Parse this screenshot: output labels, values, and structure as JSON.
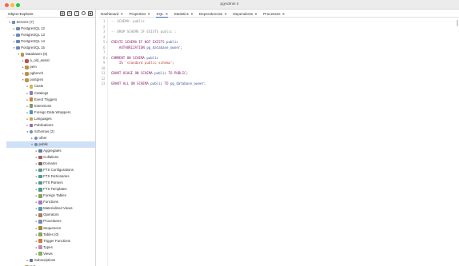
{
  "window": {
    "title": "pgAdmin 4"
  },
  "explorer": {
    "title": "Object Explorer",
    "toolbar": [
      {
        "name": "table-view-icon",
        "glyph": "▦"
      },
      {
        "name": "grid-icon",
        "glyph": "⊞"
      },
      {
        "name": "sql-icon",
        "glyph": "≡"
      },
      {
        "name": "search-icon",
        "glyph": "⌕"
      },
      {
        "name": "terminal-icon",
        "glyph": "▣"
      }
    ],
    "tree": [
      {
        "depth": 0,
        "caret": "▾",
        "icon": "ic-server",
        "label": "Servers (7)"
      },
      {
        "depth": 1,
        "caret": "▸",
        "icon": "ic-server",
        "label": "PostgreSQL 12"
      },
      {
        "depth": 1,
        "caret": "▸",
        "icon": "ic-server",
        "label": "PostgreSQL 13"
      },
      {
        "depth": 1,
        "caret": "▸",
        "icon": "ic-server",
        "label": "PostgreSQL 14"
      },
      {
        "depth": 1,
        "caret": "▾",
        "icon": "ic-server",
        "label": "PostgreSQL 15"
      },
      {
        "depth": 2,
        "caret": "▾",
        "icon": "ic-db",
        "label": "Databases (5)"
      },
      {
        "depth": 3,
        "caret": "▸",
        "icon": "ic-db-red",
        "label": "a_old_assist"
      },
      {
        "depth": 3,
        "caret": "▸",
        "icon": "ic-db",
        "label": "pem"
      },
      {
        "depth": 3,
        "caret": "▸",
        "icon": "ic-db",
        "label": "pgbench"
      },
      {
        "depth": 3,
        "caret": "▾",
        "icon": "ic-db",
        "label": "postgres"
      },
      {
        "depth": 4,
        "caret": "▸",
        "icon": "ic-folder",
        "label": "Casts"
      },
      {
        "depth": 4,
        "caret": "▸",
        "icon": "ic-cat",
        "label": "Catalogs"
      },
      {
        "depth": 4,
        "caret": "▸",
        "icon": "ic-trigger",
        "label": "Event Triggers"
      },
      {
        "depth": 4,
        "caret": "▸",
        "icon": "ic-ext",
        "label": "Extensions"
      },
      {
        "depth": 4,
        "caret": "▸",
        "icon": "ic-fdw",
        "label": "Foreign Data Wrappers"
      },
      {
        "depth": 4,
        "caret": "▸",
        "icon": "ic-lang",
        "label": "Languages"
      },
      {
        "depth": 4,
        "caret": "▸",
        "icon": "ic-pub",
        "label": "Publications"
      },
      {
        "depth": 4,
        "caret": "▾",
        "icon": "ic-schema",
        "label": "Schemas (2)"
      },
      {
        "depth": 5,
        "caret": "▸",
        "icon": "ic-schema",
        "label": "other"
      },
      {
        "depth": 5,
        "caret": "▾",
        "icon": "ic-schema",
        "label": "public",
        "selected": true
      },
      {
        "depth": 6,
        "caret": "▸",
        "icon": "ic-agg",
        "label": "Aggregates"
      },
      {
        "depth": 6,
        "caret": "▸",
        "icon": "ic-coll",
        "label": "Collations"
      },
      {
        "depth": 6,
        "caret": "▸",
        "icon": "ic-dom",
        "label": "Domains"
      },
      {
        "depth": 6,
        "caret": "▸",
        "icon": "ic-fts",
        "label": "FTS Configurations"
      },
      {
        "depth": 6,
        "caret": "▸",
        "icon": "ic-fts",
        "label": "FTS Dictionaries"
      },
      {
        "depth": 6,
        "caret": "▸",
        "icon": "ic-fts",
        "label": "FTS Parsers"
      },
      {
        "depth": 6,
        "caret": "▸",
        "icon": "ic-fts",
        "label": "FTS Templates"
      },
      {
        "depth": 6,
        "caret": "▸",
        "icon": "ic-table",
        "label": "Foreign Tables"
      },
      {
        "depth": 6,
        "caret": "▸",
        "icon": "ic-fn",
        "label": "Functions"
      },
      {
        "depth": 6,
        "caret": "▸",
        "icon": "ic-mview",
        "label": "Materialized Views"
      },
      {
        "depth": 6,
        "caret": "▸",
        "icon": "ic-op",
        "label": "Operators"
      },
      {
        "depth": 6,
        "caret": "▸",
        "icon": "ic-proc",
        "label": "Procedures"
      },
      {
        "depth": 6,
        "caret": "▸",
        "icon": "ic-seq",
        "label": "Sequences"
      },
      {
        "depth": 6,
        "caret": "▸",
        "icon": "ic-table",
        "label": "Tables (0)"
      },
      {
        "depth": 6,
        "caret": "▸",
        "icon": "ic-trigger",
        "label": "Trigger Functions"
      },
      {
        "depth": 6,
        "caret": "▸",
        "icon": "ic-type",
        "label": "Types"
      },
      {
        "depth": 6,
        "caret": "▸",
        "icon": "ic-view",
        "label": "Views"
      },
      {
        "depth": 4,
        "caret": "▸",
        "icon": "ic-sub",
        "label": "Subscriptions"
      },
      {
        "depth": 3,
        "caret": "▸",
        "icon": "ic-db",
        "label": "test"
      }
    ]
  },
  "tabs": [
    {
      "label": "Dashboard",
      "active": false
    },
    {
      "label": "Properties",
      "active": false
    },
    {
      "label": "SQL",
      "active": true
    },
    {
      "label": "Statistics",
      "active": false
    },
    {
      "label": "Dependencies",
      "active": false
    },
    {
      "label": "Dependents",
      "active": false
    },
    {
      "label": "Processes",
      "active": false
    }
  ],
  "tab_close_glyph": "×",
  "editor": {
    "lines": [
      {
        "n": "1",
        "fold": "",
        "tokens": [
          {
            "t": "-- SCHEMA: public",
            "c": "tok-comment"
          }
        ]
      },
      {
        "n": "2",
        "fold": "",
        "tokens": []
      },
      {
        "n": "3",
        "fold": "",
        "tokens": [
          {
            "t": "-- DROP SCHEMA IF EXISTS public ;",
            "c": "tok-comment"
          }
        ]
      },
      {
        "n": "4",
        "fold": "",
        "tokens": []
      },
      {
        "n": "5",
        "fold": "▾",
        "tokens": [
          {
            "t": "CREATE SCHEMA IF NOT EXISTS ",
            "c": "tok-kw"
          },
          {
            "t": "public",
            "c": "tok-id"
          }
        ]
      },
      {
        "n": "6",
        "fold": "",
        "tokens": [
          {
            "t": "    AUTHORIZATION ",
            "c": "tok-kw"
          },
          {
            "t": "pg_database_owner",
            "c": "tok-id"
          },
          {
            "t": ";",
            "c": "tok-plain"
          }
        ]
      },
      {
        "n": "7",
        "fold": "",
        "tokens": []
      },
      {
        "n": "8",
        "fold": "▾",
        "tokens": [
          {
            "t": "COMMENT ON SCHEMA ",
            "c": "tok-kw"
          },
          {
            "t": "public",
            "c": "tok-id"
          }
        ]
      },
      {
        "n": "9",
        "fold": "",
        "tokens": [
          {
            "t": "    IS ",
            "c": "tok-kw"
          },
          {
            "t": "'standard public schema'",
            "c": "tok-str"
          },
          {
            "t": ";",
            "c": "tok-plain"
          }
        ]
      },
      {
        "n": "10",
        "fold": "",
        "tokens": []
      },
      {
        "n": "11",
        "fold": "",
        "tokens": [
          {
            "t": "GRANT USAGE ON SCHEMA ",
            "c": "tok-kw"
          },
          {
            "t": "public",
            "c": "tok-id"
          },
          {
            "t": " TO PUBLIC",
            "c": "tok-kw"
          },
          {
            "t": ";",
            "c": "tok-plain"
          }
        ]
      },
      {
        "n": "12",
        "fold": "",
        "tokens": []
      },
      {
        "n": "13",
        "fold": "",
        "tokens": [
          {
            "t": "GRANT ALL ON SCHEMA ",
            "c": "tok-kw"
          },
          {
            "t": "public",
            "c": "tok-id"
          },
          {
            "t": " TO ",
            "c": "tok-kw"
          },
          {
            "t": "pg_database_owner",
            "c": "tok-id"
          },
          {
            "t": ";",
            "c": "tok-plain"
          }
        ]
      }
    ]
  }
}
